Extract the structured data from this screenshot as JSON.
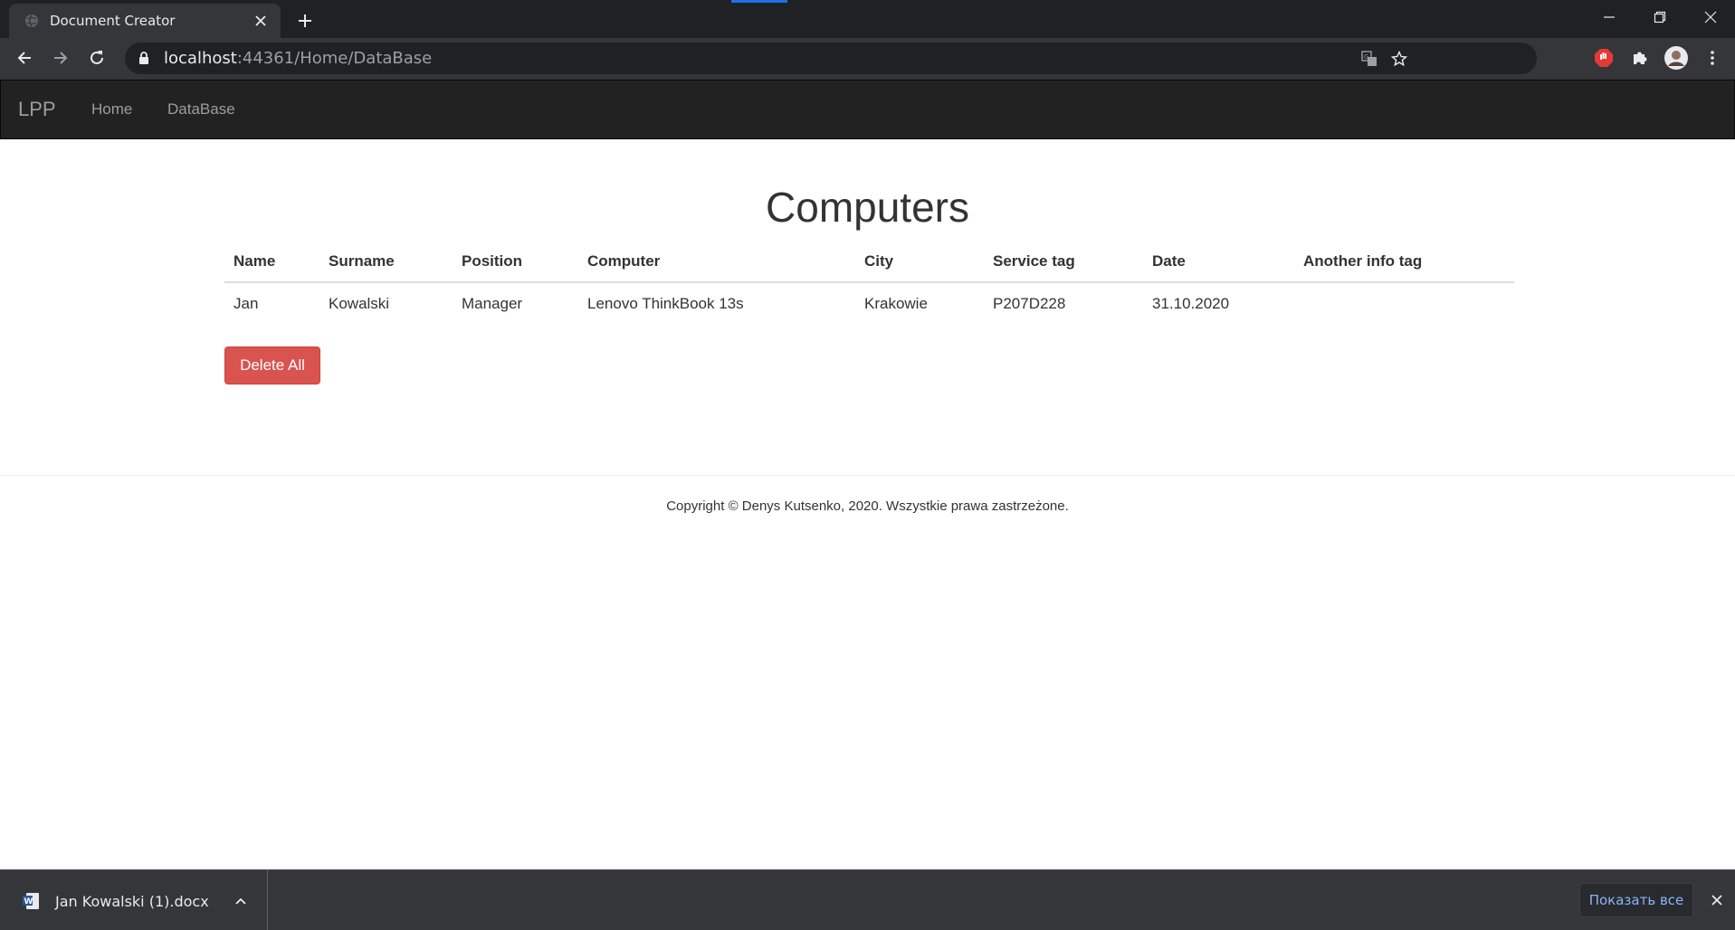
{
  "browser": {
    "tab_title": "Document Creator",
    "url_host": "localhost",
    "url_rest": ":44361/Home/DataBase"
  },
  "site": {
    "brand": "LPP",
    "nav": [
      {
        "label": "Home"
      },
      {
        "label": "DataBase"
      }
    ]
  },
  "main": {
    "heading": "Computers",
    "table": {
      "headers": [
        "Name",
        "Surname",
        "Position",
        "Computer",
        "City",
        "Service tag",
        "Date",
        "Another info tag"
      ],
      "rows": [
        [
          "Jan",
          "Kowalski",
          "Manager",
          "Lenovo ThinkBook 13s",
          "Krakowie",
          "P207D228",
          "31.10.2020",
          ""
        ]
      ]
    },
    "delete_all_label": "Delete All"
  },
  "footer": {
    "text": "Copyright © Denys Kutsenko, 2020. Wszystkie prawa zastrzeżone."
  },
  "downloads": {
    "file_name": "Jan Kowalski (1).docx",
    "show_all_label": "Показать все"
  },
  "colors": {
    "danger": "#d9534f",
    "navbar": "#222222",
    "chrome_dark": "#202124",
    "chrome_toolbar": "#35363a",
    "link_blue": "#8ab4f8"
  }
}
